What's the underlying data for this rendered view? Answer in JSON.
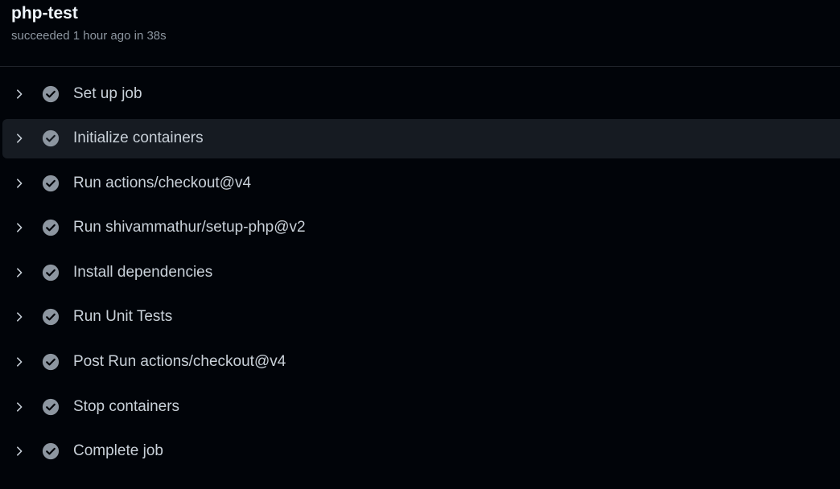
{
  "job": {
    "title": "php-test",
    "status": "succeeded 1 hour ago in 38s"
  },
  "steps": [
    {
      "label": "Set up job",
      "icon": "check-circle-icon"
    },
    {
      "label": "Initialize containers",
      "icon": "check-circle-icon"
    },
    {
      "label": "Run actions/checkout@v4",
      "icon": "check-circle-icon"
    },
    {
      "label": "Run shivammathur/setup-php@v2",
      "icon": "check-circle-icon"
    },
    {
      "label": "Install dependencies",
      "icon": "check-circle-icon"
    },
    {
      "label": "Run Unit Tests",
      "icon": "check-circle-icon"
    },
    {
      "label": "Post Run actions/checkout@v4",
      "icon": "check-circle-icon"
    },
    {
      "label": "Stop containers",
      "icon": "check-circle-icon"
    },
    {
      "label": "Complete job",
      "icon": "check-circle-icon"
    }
  ],
  "colors": {
    "background": "#010409",
    "hover_row": "#161b22",
    "check": "#8d96a0"
  }
}
